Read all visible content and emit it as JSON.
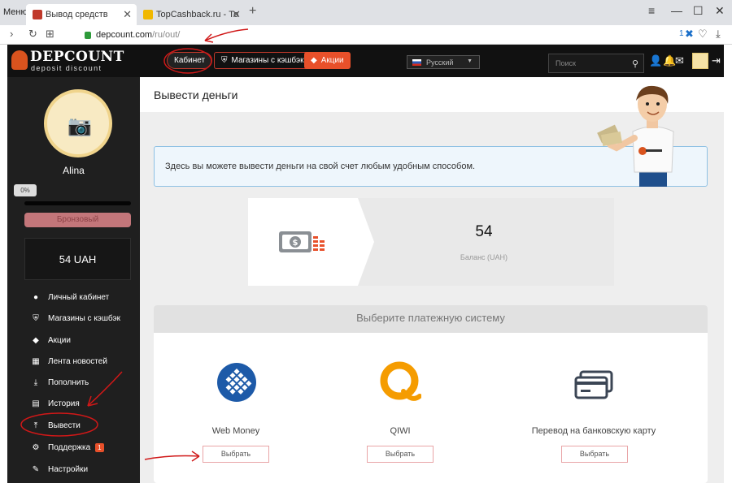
{
  "browser": {
    "menu_label": "Меню",
    "tabs": [
      {
        "title": "Вывод средств"
      },
      {
        "title": "TopCashback.ru - Топ луч"
      }
    ],
    "url_host": "depcount.com",
    "url_path": "/ru/out/",
    "extension_badge": "1"
  },
  "brand": {
    "name": "DEPCOUNT",
    "tagline": "deposit discount",
    "logo_color": "#d9531e"
  },
  "header_nav": {
    "cabinet": "Кабинет",
    "shops": "Магазины с кэшбэк",
    "promo": "Акции",
    "language": "Русский",
    "search_placeholder": "Поиск"
  },
  "sidebar": {
    "username": "Alina",
    "progress_label": "0%",
    "progress_fraction": 0.0,
    "level": "Бронзовый",
    "balance": "54 UAH",
    "items": [
      {
        "label": "Личный кабинет",
        "icon": "user-icon"
      },
      {
        "label": "Магазины с кэшбэк",
        "icon": "shield-icon"
      },
      {
        "label": "Акции",
        "icon": "tag-icon"
      },
      {
        "label": "Лента новостей",
        "icon": "news-icon"
      },
      {
        "label": "Пополнить",
        "icon": "download-icon"
      },
      {
        "label": "История",
        "icon": "table-icon"
      },
      {
        "label": "Вывести",
        "icon": "upload-icon"
      },
      {
        "label": "Поддержка",
        "icon": "gear-icon",
        "badge": "1"
      },
      {
        "label": "Настройки",
        "icon": "wrench-icon"
      }
    ]
  },
  "main": {
    "title": "Вывести деньги",
    "info_text": "Здесь вы можете вывести деньги на свой счет любым удобным способом.",
    "balance_amount": "54",
    "balance_caption": "Баланс (UAH)",
    "pay_title": "Выберите платежную систему",
    "methods": [
      {
        "name": "Web Money",
        "button": "Выбрать",
        "icon": "webmoney-icon"
      },
      {
        "name": "QIWI",
        "button": "Выбрать",
        "icon": "qiwi-icon"
      },
      {
        "name": "Перевод на банковскую карту",
        "button": "Выбрать",
        "icon": "bank-card-icon"
      }
    ]
  },
  "colors": {
    "accent": "#e8502a",
    "header_bg": "#111111",
    "info_border": "#8ec1e4",
    "webmoney": "#1d5aa8",
    "qiwi": "#f59c00"
  }
}
